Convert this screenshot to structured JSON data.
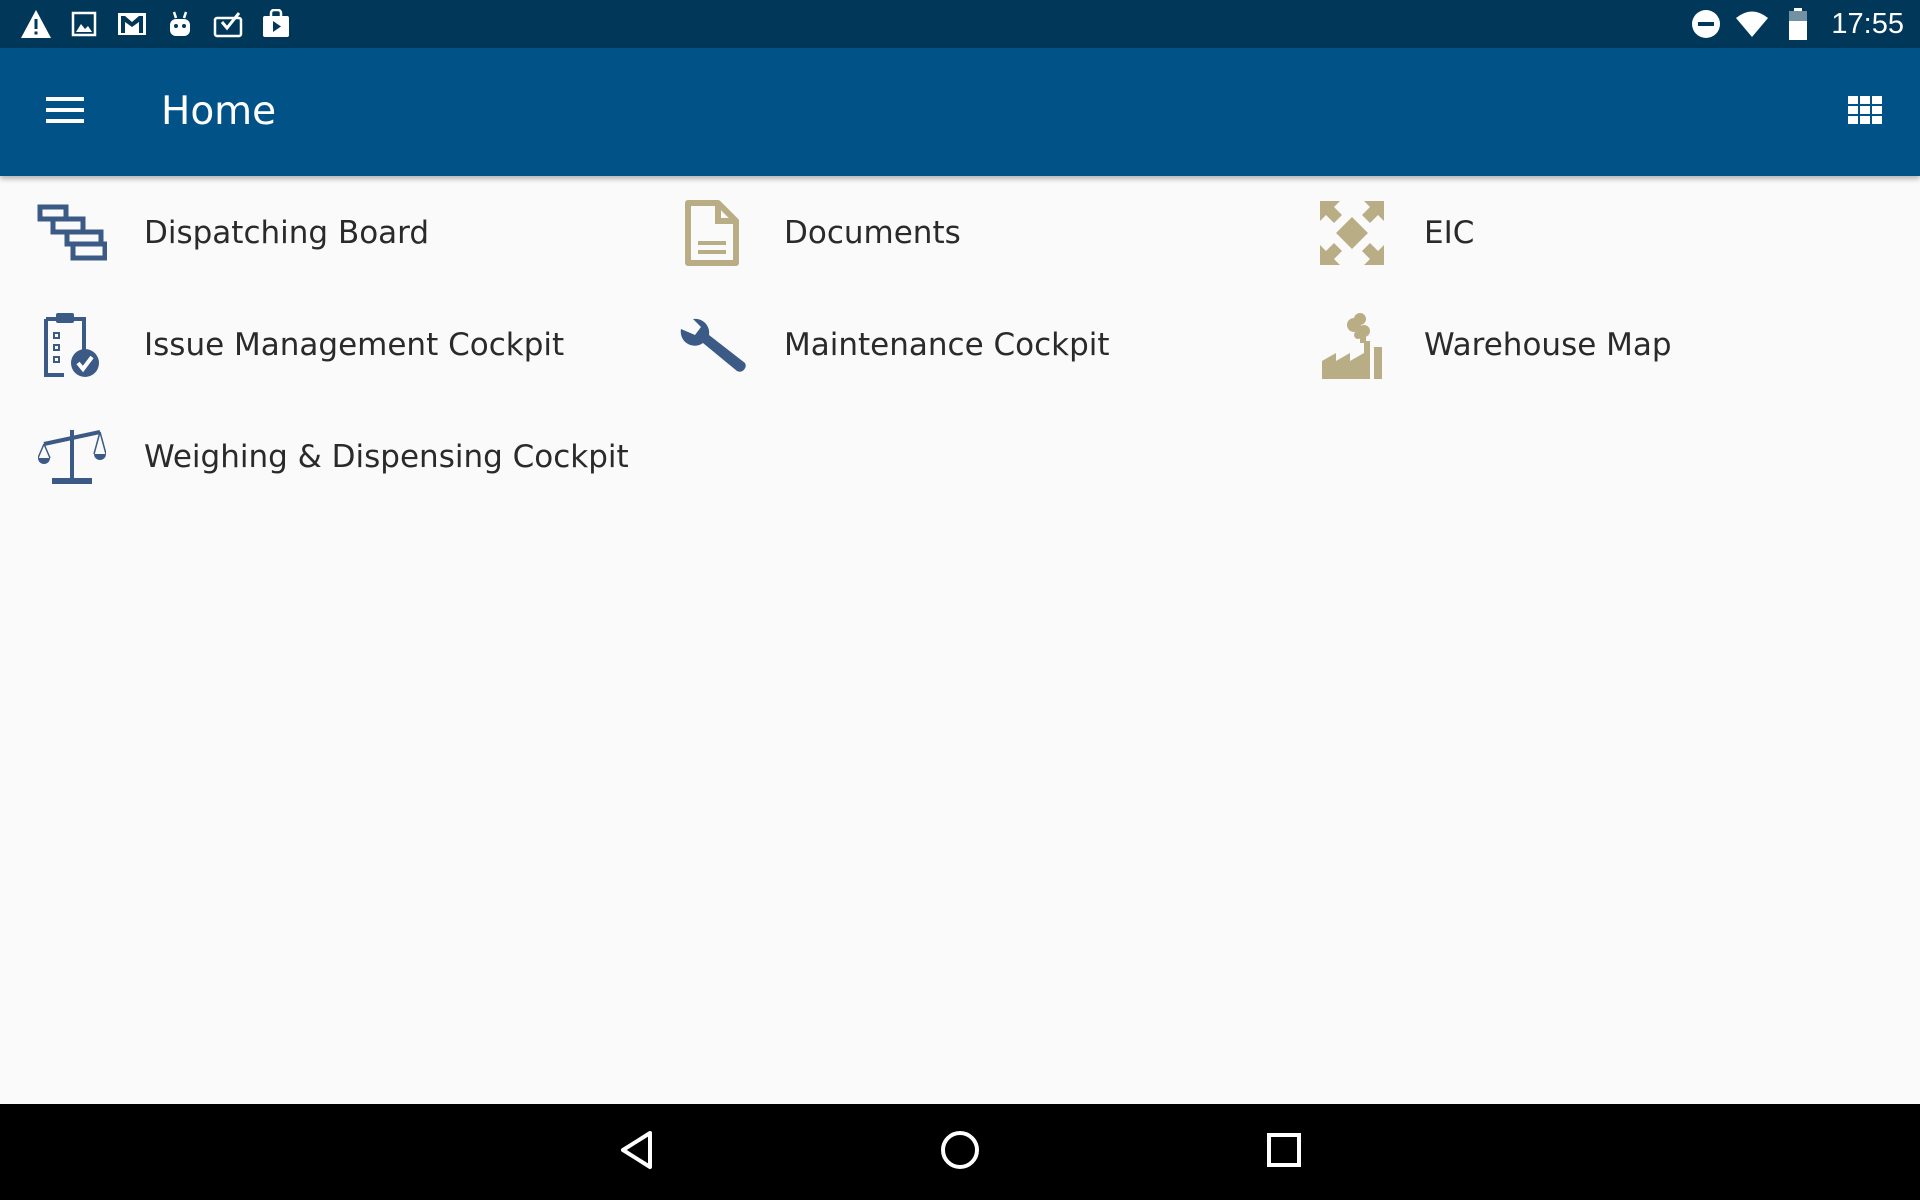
{
  "status_bar": {
    "time": "17:55",
    "left_icons": [
      "warning-icon",
      "image-icon",
      "gmail-icon",
      "android-icon",
      "checked-list-icon",
      "play-store-icon"
    ],
    "right_icons": [
      "do-not-disturb-icon",
      "wifi-icon",
      "battery-icon"
    ]
  },
  "app_bar": {
    "title": "Home",
    "menu_icon": "hamburger-menu-icon",
    "view_icon": "grid-view-icon",
    "background": "#005287"
  },
  "tiles": [
    {
      "label": "Dispatching Board",
      "icon": "dispatching-board-icon",
      "color": "#3c5a86"
    },
    {
      "label": "Documents",
      "icon": "document-icon",
      "color": "#b9ad85"
    },
    {
      "label": "EIC",
      "icon": "expand-arrows-icon",
      "color": "#b9ad85"
    },
    {
      "label": "Issue Management Cockpit",
      "icon": "clipboard-check-icon",
      "color": "#3c5a86"
    },
    {
      "label": "Maintenance Cockpit",
      "icon": "wrench-icon",
      "color": "#3c5a86"
    },
    {
      "label": "Warehouse Map",
      "icon": "factory-icon",
      "color": "#b9ad85"
    },
    {
      "label": "Weighing & Dispensing Cockpit",
      "icon": "scale-icon",
      "color": "#3c5a86"
    }
  ],
  "nav_bar": {
    "icons": [
      "back-icon",
      "home-icon",
      "recents-icon"
    ]
  }
}
